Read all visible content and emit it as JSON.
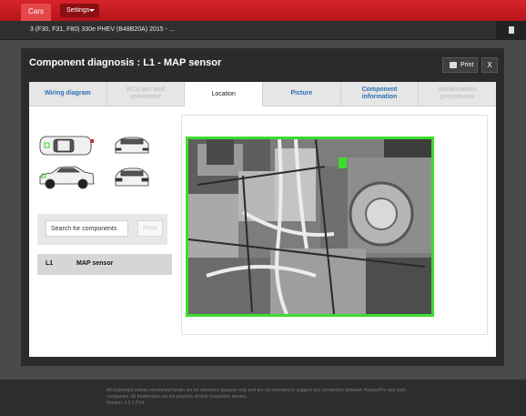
{
  "topbar": {
    "cars_tab": "Cars",
    "settings_label": "Settings",
    "settings_icon": "chevron-down-icon"
  },
  "vehicle": {
    "title": "3 (F30, F31, F80) 330e PHEV (B48B20A) 2015 - ...",
    "action_icon": "document-icon"
  },
  "modal": {
    "title": "Component diagnosis : L1 - MAP sensor",
    "print_label": "Print",
    "print_icon": "printer-icon",
    "close_label": "X",
    "tabs": [
      {
        "label": "Wiring diagram",
        "state": "enabled"
      },
      {
        "label": "ECU pin and connector",
        "state": "disabled"
      },
      {
        "label": "Location",
        "state": "active"
      },
      {
        "label": "Picture",
        "state": "enabled"
      },
      {
        "label": "Component information",
        "state": "enabled"
      },
      {
        "label": "Initialisation procedures",
        "state": "disabled"
      }
    ],
    "search": {
      "placeholder": "Search for components",
      "reset_label": "Reset"
    },
    "components": [
      {
        "code": "L1",
        "name": "MAP sensor"
      }
    ]
  },
  "colors": {
    "brand_red": "#d8232a",
    "tab_link": "#2d6fb4",
    "highlight_green": "#3ddc2e"
  },
  "footer": {
    "line1": "All trademark names mentioned herein are for reference purpose only and are not intended to suggest any connection between HaynesPro and such",
    "line2": "companies. All trademarks are the property of their respective owners.",
    "line3": "Version: 3.2.1-P14"
  }
}
